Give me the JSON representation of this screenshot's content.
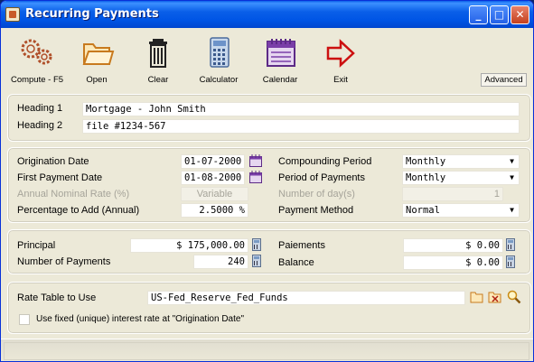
{
  "window": {
    "title": "Recurring Payments",
    "controls": {
      "minimize": "_",
      "maximize": "□",
      "close": "✕"
    }
  },
  "toolbar": {
    "compute": {
      "label": "Compute - F5",
      "icon": "gears-icon"
    },
    "open": {
      "label": "Open",
      "icon": "folder-icon"
    },
    "clear": {
      "label": "Clear",
      "icon": "trash-icon"
    },
    "calculator": {
      "label": "Calculator",
      "icon": "calculator-icon"
    },
    "calendar": {
      "label": "Calendar",
      "icon": "calendar-icon"
    },
    "exit": {
      "label": "Exit",
      "icon": "exit-arrow-icon"
    },
    "advanced_label": "Advanced"
  },
  "headings": {
    "heading1_label": "Heading 1",
    "heading1_value": "Mortgage - John Smith",
    "heading2_label": "Heading 2",
    "heading2_value": "file #1234-567"
  },
  "terms": {
    "origination_date_label": "Origination Date",
    "origination_date_value": "01-07-2000",
    "first_payment_label": "First Payment Date",
    "first_payment_value": "01-08-2000",
    "annual_rate_label": "Annual Nominal Rate (%)",
    "annual_rate_value": "Variable",
    "pct_add_label": "Percentage to Add (Annual)",
    "pct_add_value": "2.5000 %",
    "compounding_label": "Compounding Period",
    "compounding_value": "Monthly",
    "period_payments_label": "Period of Payments",
    "period_payments_value": "Monthly",
    "num_days_label": "Number of day(s)",
    "num_days_value": "1",
    "payment_method_label": "Payment Method",
    "payment_method_value": "Normal"
  },
  "amounts": {
    "principal_label": "Principal",
    "principal_value": "$ 175,000.00",
    "num_payments_label": "Number of Payments",
    "num_payments_value": "240",
    "paiements_label": "Paiements",
    "paiements_value": "$ 0.00",
    "balance_label": "Balance",
    "balance_value": "$ 0.00"
  },
  "rate_table": {
    "label": "Rate Table to Use",
    "value": "US-Fed_Reserve_Fed_Funds",
    "fixed_rate_label": "Use fixed (unique) interest rate at \"Origination Date\"",
    "fixed_rate_checked": false
  },
  "colors": {
    "titlebar": "#0055e5",
    "window_bg": "#ece9d8",
    "close_button": "#c4401e",
    "disabled_text": "#a6a49a"
  }
}
